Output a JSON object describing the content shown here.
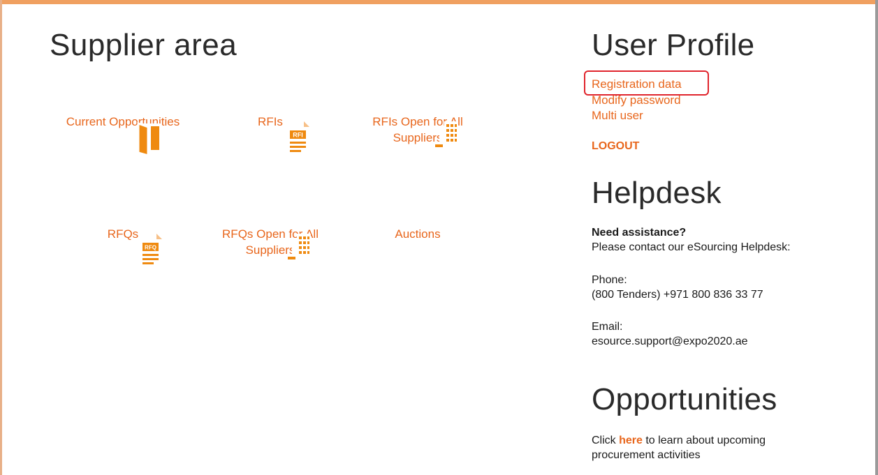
{
  "supplier": {
    "title": "Supplier area",
    "tiles": [
      {
        "label": "Current Opportunities",
        "icon": "door-icon"
      },
      {
        "label": "RFIs",
        "icon": "rfi-document-icon"
      },
      {
        "label": "RFIs Open for All Suppliers",
        "icon": "factory-icon"
      },
      {
        "label": "RFQs",
        "icon": "rfq-document-icon"
      },
      {
        "label": "RFQs Open for All Suppliers",
        "icon": "factory-icon"
      },
      {
        "label": "Auctions",
        "icon": "gavel-icon"
      }
    ],
    "rfi_badge": "RFI",
    "rfq_badge": "RFQ"
  },
  "profile": {
    "title": "User Profile",
    "links": [
      "Registration data",
      "Modify password",
      "Multi user"
    ],
    "logout": "LOGOUT"
  },
  "helpdesk": {
    "title": "Helpdesk",
    "assist_heading": "Need assistance?",
    "assist_text": "Please contact our eSourcing Helpdesk:",
    "phone_label": "Phone:",
    "phone_value": "(800 Tenders) +971 800 836 33 77",
    "email_label": "Email:",
    "email_value": "esource.support@expo2020.ae"
  },
  "opportunities": {
    "title": "Opportunities",
    "text_before": "Click ",
    "link": "here",
    "text_after": " to learn about upcoming procurement activities"
  },
  "colors": {
    "accent": "#ef8a10",
    "link": "#e8661c",
    "highlight": "#e0242c"
  }
}
